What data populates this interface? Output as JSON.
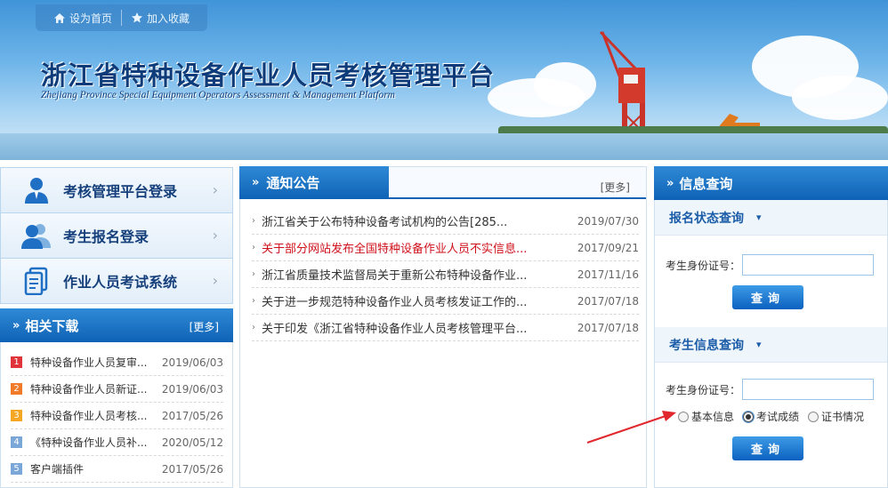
{
  "header": {
    "toplinks": [
      {
        "label": "设为首页",
        "icon": "home-icon"
      },
      {
        "label": "加入收藏",
        "icon": "star-icon"
      }
    ],
    "title": "浙江省特种设备作业人员考核管理平台",
    "subtitle": "Zhejiang Province Special Equipment Operators Assessment & Management Platform"
  },
  "side_nav": {
    "items": [
      {
        "label": "考核管理平台登录",
        "icon": "user-icon"
      },
      {
        "label": "考生报名登录",
        "icon": "users-icon"
      },
      {
        "label": "作业人员考试系统",
        "icon": "document-icon"
      }
    ]
  },
  "downloads": {
    "title": "相关下载",
    "more": "[更多]",
    "items": [
      {
        "num": "1",
        "title": "特种设备作业人员复审...",
        "date": "2019/06/03",
        "color": "#e0343a"
      },
      {
        "num": "2",
        "title": "特种设备作业人员新证...",
        "date": "2019/06/03",
        "color": "#f07a28"
      },
      {
        "num": "3",
        "title": "特种设备作业人员考核...",
        "date": "2017/05/26",
        "color": "#f5a623"
      },
      {
        "num": "4",
        "title": "《特种设备作业人员补...",
        "date": "2020/05/12",
        "color": "#7ba6d8"
      },
      {
        "num": "5",
        "title": "客户端插件",
        "date": "2017/05/26",
        "color": "#7ba6d8"
      }
    ]
  },
  "notices": {
    "title": "通知公告",
    "more": "[更多]",
    "items": [
      {
        "title": "浙江省关于公布特种设备考试机构的公告[285...",
        "date": "2019/07/30",
        "highlight": false
      },
      {
        "title": "关于部分网站发布全国特种设备作业人员不实信息...",
        "date": "2017/09/21",
        "highlight": true
      },
      {
        "title": "浙江省质量技术监督局关于重新公布特种设备作业...",
        "date": "2017/11/16",
        "highlight": false
      },
      {
        "title": "关于进一步规范特种设备作业人员考核发证工作的...",
        "date": "2017/07/18",
        "highlight": false
      },
      {
        "title": "关于印发《浙江省特种设备作业人员考核管理平台...",
        "date": "2017/07/18",
        "highlight": false
      }
    ]
  },
  "query": {
    "title": "信息查询",
    "status_section": {
      "title": "报名状态查询",
      "id_label": "考生身份证号：",
      "id_value": "",
      "button": "查询"
    },
    "info_section": {
      "title": "考生信息查询",
      "id_label": "考生身份证号：",
      "id_value": "",
      "options": [
        {
          "label": "基本信息",
          "selected": false
        },
        {
          "label": "考试成绩",
          "selected": true
        },
        {
          "label": "证书情况",
          "selected": false
        }
      ],
      "button": "查询"
    }
  },
  "colors": {
    "primary_blue": "#0f62b5",
    "title_blue": "#16407c",
    "highlight_red": "#d0111b",
    "annotation_red": "#e0282e"
  }
}
